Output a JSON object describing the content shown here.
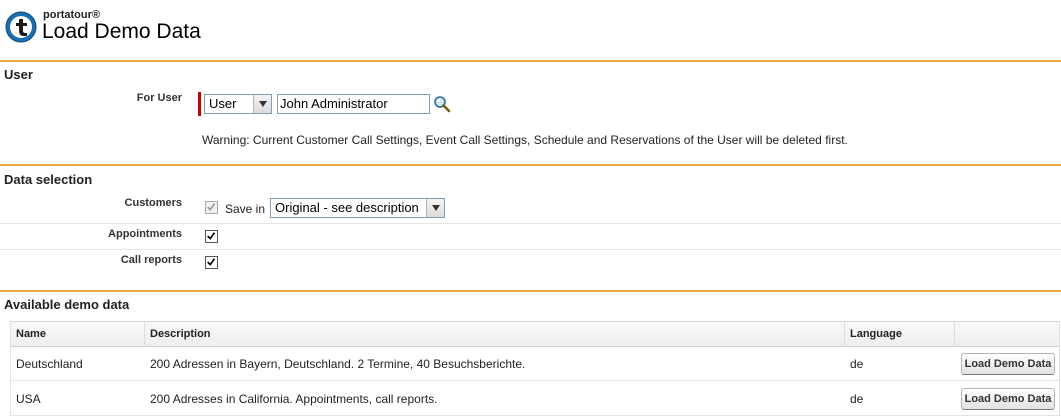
{
  "header": {
    "brand": "portatour®",
    "title": "Load Demo Data"
  },
  "user_section": {
    "title": "User",
    "for_user_label": "For User",
    "user_type_select": "User",
    "user_name_value": "John Administrator",
    "warning": "Warning: Current Customer Call Settings, Event Call Settings, Schedule and Reservations of the User will be deleted first."
  },
  "data_selection": {
    "title": "Data selection",
    "customers_label": "Customers",
    "customers_checked": true,
    "customers_disabled": true,
    "save_in_label": "Save in",
    "save_in_select": "Original - see description",
    "appointments_label": "Appointments",
    "appointments_checked": true,
    "call_reports_label": "Call reports",
    "call_reports_checked": true
  },
  "available": {
    "title": "Available demo data",
    "columns": {
      "name": "Name",
      "description": "Description",
      "language": "Language"
    },
    "rows": [
      {
        "name": "Deutschland",
        "description": "200 Adressen in Bayern, Deutschland. 2 Termine, 40 Besuchsberichte.",
        "language": "de",
        "button": "Load Demo Data"
      },
      {
        "name": "USA",
        "description": "200 Adresses in California. Appointments, call reports.",
        "language": "de",
        "button": "Load Demo Data"
      }
    ]
  },
  "colors": {
    "section_accent": "#e8a73c",
    "required_marker": "#cc0000",
    "logo_blue": "#1b6fb0"
  },
  "icons": {
    "logo": "portatour-logo-icon",
    "lookup": "magnifier-lookup-icon",
    "dropdown": "chevron-down-icon",
    "checkmark": "checkmark-icon"
  }
}
